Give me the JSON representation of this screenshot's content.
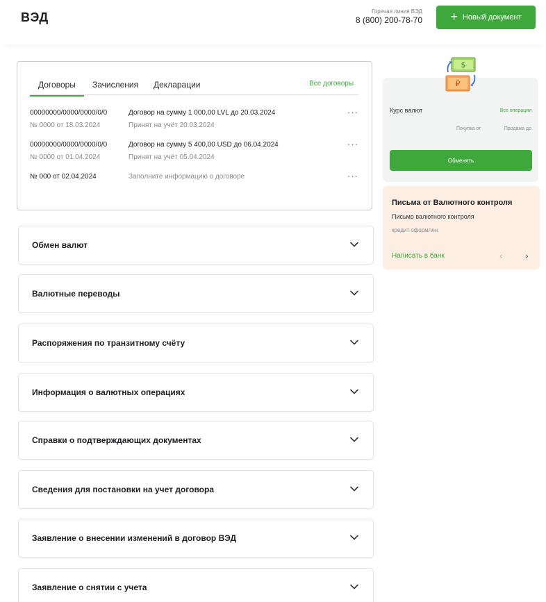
{
  "header": {
    "title": "ВЭД",
    "hotline_label": "Горячая линия ВЭД",
    "hotline_phone": "8 (800) 200-78-70",
    "new_document_label": "Новый документ"
  },
  "contracts": {
    "tabs": [
      "Договоры",
      "Зачисления",
      "Декларации"
    ],
    "active_tab": "Договоры",
    "all_link": "Все договоры",
    "rows": [
      {
        "id": "00000000/0000/0000/0/0",
        "number": "№ 0000 от 18.03.2024",
        "description": "Договор на сумму 1 000,00 LVL до 20.03.2024",
        "status": "Принят на учёт 20.03.2024"
      },
      {
        "id": "00000000/0000/0000/0/0",
        "number": "№ 0000 от 01.04.2024",
        "description": "Договор на сумму 5 400,00 USD до 06.04.2024",
        "status": "Принят на учёт 05.04.2024"
      },
      {
        "id": "№ 000 от 02.04.2024",
        "number": "",
        "description": "Заполните информацию о договоре",
        "status": ""
      }
    ],
    "more_label": "···"
  },
  "sections": [
    "Обмен валют",
    "Валютные переводы",
    "Распоряжения по транзитному счёту",
    "Информация о валютных операциях",
    "Справки о подтверждающих документах",
    "Сведения для постановки на учет договора",
    "Заявление о внесении изменений в договор ВЭД",
    "Заявление о снятии с учета"
  ],
  "rates": {
    "title": "Курс валют",
    "ops_link": "Все операции",
    "buy_label": "Покупка от",
    "sell_label": "Продажа до",
    "button_label": "Обменять"
  },
  "letters": {
    "title": "Письма от Валютного контроля",
    "subtitle": "Письмо валютного контроля",
    "status": "кредит оформлен",
    "link": "Написать в банк",
    "prev_label": "‹",
    "next_label": "›"
  },
  "colors": {
    "accent": "#3ea83c",
    "letters_bg": "#fdeee4",
    "rates_bg": "#f2f3f3"
  },
  "icons": {
    "plus": "plus-icon",
    "chevron": "chevron-down-icon",
    "more": "more-dots-icon",
    "exchange": "currency-exchange-illustration"
  }
}
